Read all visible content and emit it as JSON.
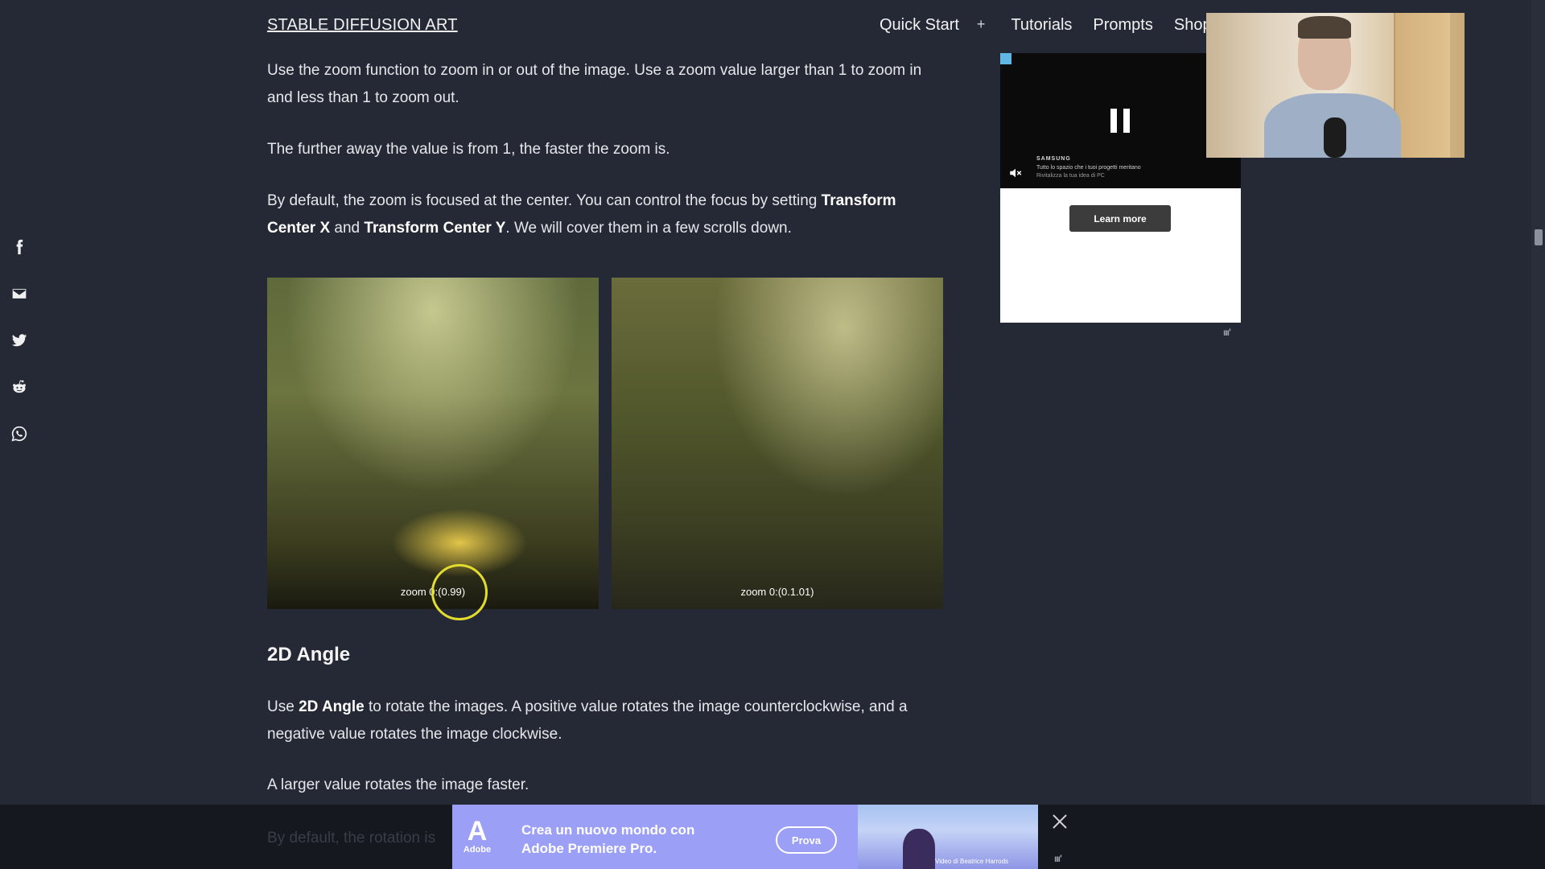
{
  "header": {
    "site_title": "STABLE DIFFUSION ART",
    "nav": [
      "Quick Start",
      "+",
      "Tutorials",
      "Prompts",
      "Shop"
    ]
  },
  "share_icons": [
    "facebook-icon",
    "email-icon",
    "twitter-icon",
    "reddit-icon",
    "whatsapp-icon"
  ],
  "article": {
    "p1": "Use the zoom function to zoom in or out of the image. Use a zoom value larger than 1 to zoom in and less than 1 to zoom out.",
    "p2": "The further away the value is from 1, the faster the zoom is.",
    "p3_a": "By default, the zoom is focused at the center. You can control the focus by setting ",
    "p3_b": "Transform Center X",
    "p3_c": " and ",
    "p3_d": "Transform Center Y",
    "p3_e": ". We will cover them in a few scrolls down.",
    "images": [
      {
        "caption": "zoom 0:(0.99)"
      },
      {
        "caption": "zoom 0:(0.1.01)"
      }
    ],
    "h2": "2D Angle",
    "p4_a": "Use ",
    "p4_b": "2D Angle",
    "p4_c": " to rotate the images. A positive value rotates the image counterclockwise, and a negative value rotates the image clockwise.",
    "p5": "A larger value rotates the image faster.",
    "p6_partial": "By default, the rotation is"
  },
  "side_ad": {
    "brand": "SAMSUNG",
    "line1": "Tutto lo spazio che i tuoi progetti meritano",
    "line2": "Rivitalizza la tua idea di PC",
    "cta": "Learn more"
  },
  "bottom_ad": {
    "logo_word": "Adobe",
    "text_line1": "Crea un nuovo mondo con",
    "text_line2": "Adobe Premiere Pro.",
    "cta": "Prova",
    "credit": "Video di Beatrice Harrods"
  }
}
